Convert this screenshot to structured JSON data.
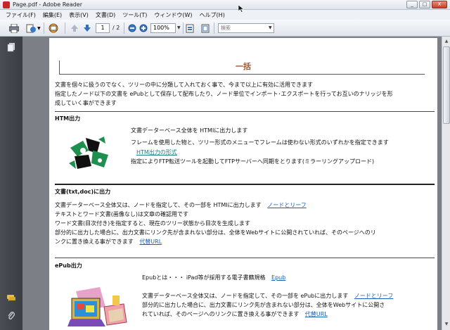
{
  "window": {
    "title": "Page.pdf - Adobe Reader",
    "buttons": [
      "_",
      "□",
      "X"
    ]
  },
  "menu": [
    "ファイル(F)",
    "編集(E)",
    "表示(V)",
    "文書(D)",
    "ツール(T)",
    "ウィンドウ(W)",
    "ヘルプ(H)"
  ],
  "toolbar": {
    "page_current": "1",
    "page_total": "/ 2",
    "zoom": "100%",
    "search_placeholder": "検索"
  },
  "doc": {
    "heading": "一括",
    "intro": [
      "文書を個々に扱うのでなく、ツリーの中に分類して入れておく事で、今まで以上に有効に活用できます",
      "指定したノード以下の文書を ePubとして保存して配布したり、ノード単位でインポート･エクスポートを行ってお互いのナリッジを形",
      "成していく事ができます"
    ],
    "htm": {
      "title": "HTM出力",
      "line1": "文書データーベース全体を HTMIに出力します",
      "line2": "フレームを使用した物と、ツリー形式のメニューでフレームは使わない形式のいずれかを指定できます",
      "link": "HTM出力の形式",
      "line3": "指定によりFTP転送ツールを起動してFTPサーバーへ同期をとります(ミラーリングアップロード)"
    },
    "txt": {
      "title": "文書(txt,doc)に出力",
      "line1": "文書データーベース全体又は、ノードを指定して、その一部を HTMIに出力します",
      "link1": "ノードとリーフ",
      "line2": "テキストとワード文書(画像なし)は文章の確認用です",
      "line3": "ワード文書(目次付き)を指定すると、現在のツリー状態から目次を生成します",
      "line4": "部分的に出力した場合に、出力文書にリンク先が含まれない部分は、全体をWebサイトに公開されていれば、そのページへのリ",
      "line5": "ンクに置き換える事ができます",
      "link2": "代替URL"
    },
    "epub": {
      "title": "ePub出力",
      "line1": "Epubとは・・・ iPad等が採用する電子書籍規格",
      "link1": "Epub",
      "line2": "文書データーベース全体又は、ノードを指定して、その一部を ePubに出力します",
      "link2": "ノードとリーフ",
      "line3": "部分的に出力した場合に、出力文書にリンク先が含まれない部分は、全体をWebサイトに公開さ",
      "line4": "れていれば、そのページへのリンクに置き換える事ができます",
      "link3": "代替URL"
    }
  }
}
